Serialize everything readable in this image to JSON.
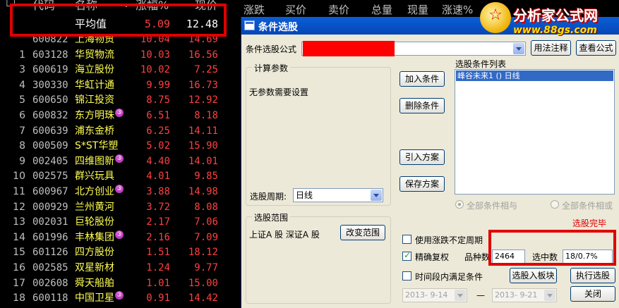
{
  "stock_table": {
    "headers": {
      "code": "代码",
      "name": "名称",
      "dot": "•",
      "pct": "涨幅%",
      "price": "现价"
    },
    "average": {
      "label": "平均值",
      "pct": "5.09",
      "price": "12.48"
    },
    "rows": [
      {
        "idx": "",
        "code": "600822",
        "name": "上海物贸",
        "pct": "10.04",
        "price": "14.69",
        "badge": ""
      },
      {
        "idx": "1",
        "code": "603128",
        "name": "华贸物流",
        "pct": "10.03",
        "price": "16.56",
        "badge": ""
      },
      {
        "idx": "3",
        "code": "600619",
        "name": "海立股份",
        "pct": "10.02",
        "price": "7.25",
        "badge": ""
      },
      {
        "idx": "4",
        "code": "300330",
        "name": "华虹计通",
        "pct": "9.99",
        "price": "16.73",
        "badge": ""
      },
      {
        "idx": "5",
        "code": "600650",
        "name": "锦江投资",
        "pct": "8.75",
        "price": "12.92",
        "badge": ""
      },
      {
        "idx": "6",
        "code": "600832",
        "name": "东方明珠",
        "pct": "6.51",
        "price": "8.18",
        "badge": "③"
      },
      {
        "idx": "7",
        "code": "600639",
        "name": "浦东金桥",
        "pct": "6.25",
        "price": "14.11",
        "badge": ""
      },
      {
        "idx": "8",
        "code": "000509",
        "name": "S*ST华塑",
        "pct": "5.02",
        "price": "15.90",
        "badge": ""
      },
      {
        "idx": "9",
        "code": "002405",
        "name": "四维图新",
        "pct": "4.40",
        "price": "14.01",
        "badge": "③"
      },
      {
        "idx": "10",
        "code": "002575",
        "name": "群兴玩具",
        "pct": "4.01",
        "price": "9.85",
        "badge": ""
      },
      {
        "idx": "11",
        "code": "600967",
        "name": "北方创业",
        "pct": "3.88",
        "price": "14.98",
        "badge": "③"
      },
      {
        "idx": "12",
        "code": "000929",
        "name": "兰州黄河",
        "pct": "3.72",
        "price": "8.08",
        "badge": ""
      },
      {
        "idx": "13",
        "code": "002031",
        "name": "巨轮股份",
        "pct": "2.17",
        "price": "7.06",
        "badge": ""
      },
      {
        "idx": "14",
        "code": "601996",
        "name": "丰林集团",
        "pct": "2.16",
        "price": "7.09",
        "badge": "③"
      },
      {
        "idx": "15",
        "code": "601126",
        "name": "四方股份",
        "pct": "1.51",
        "price": "18.12",
        "badge": ""
      },
      {
        "idx": "16",
        "code": "002585",
        "name": "双星新材",
        "pct": "1.24",
        "price": "9.77",
        "badge": ""
      },
      {
        "idx": "17",
        "code": "002608",
        "name": "舜天船舶",
        "pct": "1.01",
        "price": "15.00",
        "badge": ""
      },
      {
        "idx": "18",
        "code": "600118",
        "name": "中国卫星",
        "pct": "0.91",
        "price": "14.42",
        "badge": "③"
      }
    ]
  },
  "top_strip": [
    "涨跌",
    "买价",
    "卖价",
    "总量",
    "现量",
    "涨速%"
  ],
  "logo": {
    "text": "分析家公式网",
    "url": "www.88gs.com",
    "mark": "☆"
  },
  "dialog": {
    "title": "条件选股",
    "formula_label": "条件选股公式",
    "usage_button": "用法注释",
    "view_formula_button": "查看公式",
    "params_group": "计算参数",
    "params_text": "无参数需要设置",
    "period_label": "选股周期:",
    "period_value": "日线",
    "add_button": "加入条件",
    "remove_button": "删除条件",
    "import_button": "引入方案",
    "save_button": "保存方案",
    "list_label": "选股条件列表",
    "list_item": "峰谷未来1 () 日线",
    "radio_and": "全部条件相与",
    "radio_or": "全部条件相或",
    "status_done": "选股完毕",
    "range_group": "选股范围",
    "range_text": "上证A 股 深证A 股",
    "change_range_button": "改变范围",
    "chk_uncertain": "使用涨跌不定周期",
    "chk_exact": "精确复权",
    "count_label": "品种数",
    "count_value": "2464",
    "selected_label": "选中数",
    "selected_value": "18/0.7%",
    "chk_timerange": "时间段内满足条件",
    "to_board_button": "选股入板块",
    "run_button": "执行选股",
    "date_from": "2013- 9-14",
    "date_dash": "—",
    "date_to": "2013- 9-21",
    "close_button": "关闭"
  }
}
